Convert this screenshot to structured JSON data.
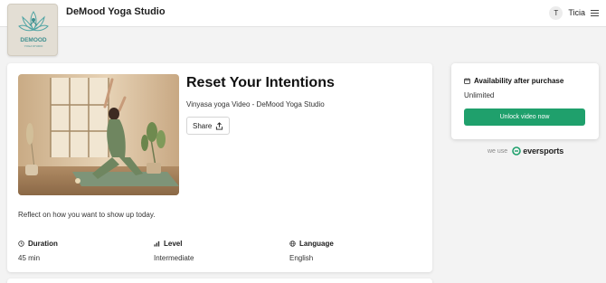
{
  "header": {
    "studio_name": "DeMood Yoga Studio",
    "logo_text": "DEMOOD",
    "logo_subtext": "YOGA STUDIO",
    "user_initial": "T",
    "user_name": "Ticia"
  },
  "video": {
    "title": "Reset Your Intentions",
    "subtitle": "Vinyasa yoga Video -  DeMood Yoga Studio",
    "share_label": "Share",
    "description": "Reflect on how you want to show up today."
  },
  "meta": {
    "duration_label": "Duration",
    "duration_value": "45 min",
    "level_label": "Level",
    "level_value": "Intermediate",
    "language_label": "Language",
    "language_value": "English"
  },
  "purchase": {
    "availability_label": "Availability after purchase",
    "availability_value": "Unlimited",
    "unlock_label": "Unlock video now",
    "we_use": "we use",
    "provider": "eversports",
    "accent_color": "#1fa06c"
  },
  "icons": {
    "menu": "hamburger-icon",
    "share": "share-upload-icon",
    "duration": "clock-icon",
    "level": "signal-bars-icon",
    "language": "globe-icon",
    "availability": "calendar-icon"
  }
}
